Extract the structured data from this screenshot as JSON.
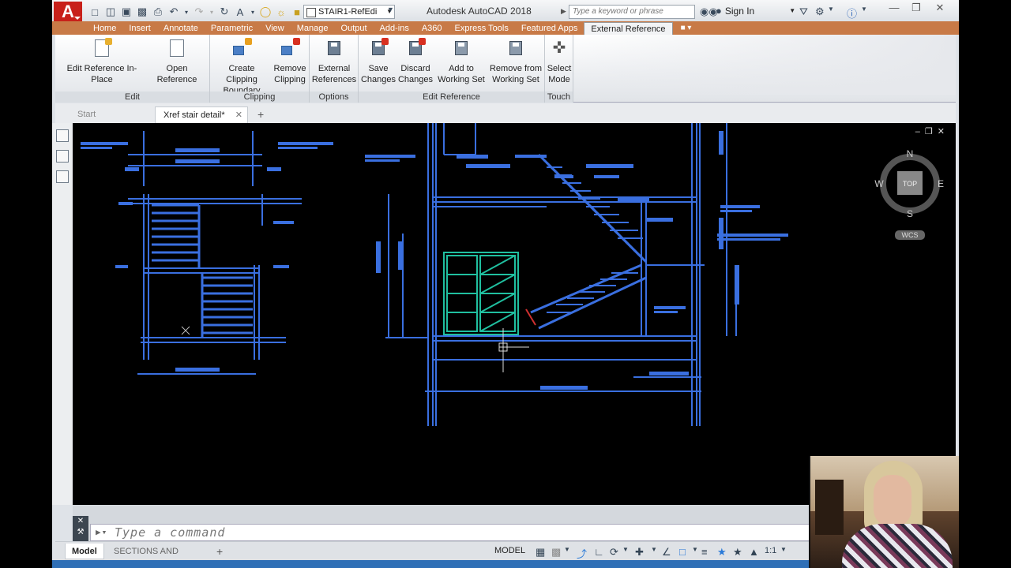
{
  "title_bar": {
    "app_title": "Autodesk AutoCAD 2018",
    "file_name": "STAIR1-RefEdi",
    "search_placeholder": "Type a keyword or phrase",
    "sign_in": "Sign In"
  },
  "ribbon_tabs": [
    "Home",
    "Insert",
    "Annotate",
    "Parametric",
    "View",
    "Manage",
    "Output",
    "Add-ins",
    "A360",
    "Express Tools",
    "Featured Apps",
    "External Reference"
  ],
  "active_tab": "External Reference",
  "panels": {
    "edit": {
      "title": "Edit",
      "edit_in_place": "Edit Reference In-Place",
      "open_reference": "Open Reference"
    },
    "clipping": {
      "title": "Clipping",
      "create_line1": "Create Clipping",
      "create_line2": "Boundary",
      "remove_line1": "Remove",
      "remove_line2": "Clipping"
    },
    "options": {
      "title": "Options",
      "xref_line1": "External",
      "xref_line2": "References"
    },
    "edit_reference": {
      "title": "Edit Reference",
      "save_line1": "Save",
      "save_line2": "Changes",
      "discard_line1": "Discard",
      "discard_line2": "Changes",
      "add_line1": "Add to",
      "add_line2": "Working Set",
      "remove_line1": "Remove from",
      "remove_line2": "Working Set"
    },
    "touch": {
      "title": "Touch",
      "select_line1": "Select",
      "select_line2": "Mode"
    }
  },
  "file_tabs": {
    "start": "Start",
    "active": "Xref stair detail*"
  },
  "viewcube": {
    "north": "N",
    "south": "S",
    "east": "E",
    "west": "W",
    "face": "TOP",
    "ucs": "WCS"
  },
  "command_line": {
    "placeholder": "Type a command"
  },
  "layout_tabs": {
    "model": "Model",
    "sections": "SECTIONS AND DETAILS"
  },
  "status": {
    "space": "MODEL",
    "scale": "1:1"
  },
  "colors": {
    "ribbon_accent": "#c87a47",
    "drawing_bg": "#000000",
    "xref_lines": "#3a6fe0",
    "edit_highlight": "#20c0a0"
  }
}
